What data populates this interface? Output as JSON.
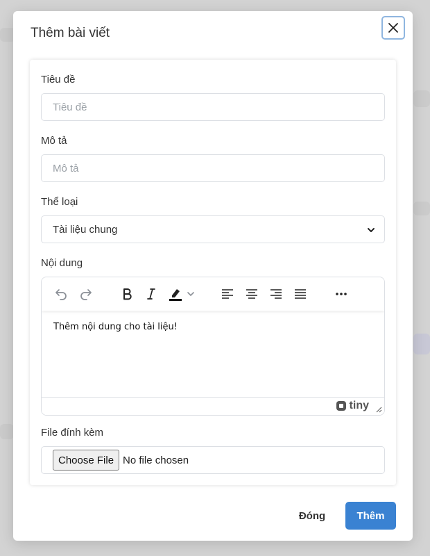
{
  "modal": {
    "title": "Thêm bài viết"
  },
  "form": {
    "title_label": "Tiêu đề",
    "title_placeholder": "Tiêu đề",
    "desc_label": "Mô tả",
    "desc_placeholder": "Mô tả",
    "category_label": "Thể loại",
    "category_value": "Tài liệu chung",
    "content_label": "Nội dung",
    "attachment_label": "File đính kèm"
  },
  "editor": {
    "content": "Thêm nội dung cho tài liệu!",
    "brand": "tiny",
    "toolbar_icons": [
      "undo-icon",
      "redo-icon",
      "bold-icon",
      "italic-icon",
      "highlight-icon",
      "align-left-icon",
      "align-center-icon",
      "align-right-icon",
      "justify-icon",
      "more-icon"
    ]
  },
  "file_input": {
    "button_label": "Choose File",
    "status": "No file chosen"
  },
  "footer": {
    "close_label": "Đóng",
    "submit_label": "Thêm"
  },
  "colors": {
    "primary": "#3a82d2",
    "backdrop": "#d3d3d3"
  }
}
